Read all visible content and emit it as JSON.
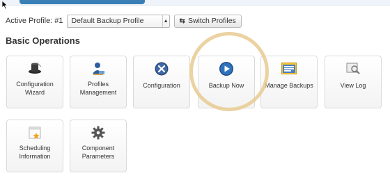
{
  "profile": {
    "label": "Active Profile: #1",
    "selected": "Default Backup Profile",
    "switch_label": "Switch Profiles"
  },
  "section": {
    "title": "Basic Operations"
  },
  "tiles": [
    {
      "label_line1": "Configuration",
      "label_line2": "Wizard",
      "icon": "top-hat-icon"
    },
    {
      "label_line1": "Profiles",
      "label_line2": "Management",
      "icon": "profiles-stamp-icon"
    },
    {
      "label_line1": "Configuration",
      "label_line2": "",
      "icon": "x-circle-icon"
    },
    {
      "label_line1": "Backup Now",
      "label_line2": "",
      "icon": "play-icon"
    },
    {
      "label_line1": "Manage Backups",
      "label_line2": "",
      "icon": "window-list-icon"
    },
    {
      "label_line1": "View Log",
      "label_line2": "",
      "icon": "magnifier-icon"
    },
    {
      "label_line1": "Scheduling",
      "label_line2": "Information",
      "icon": "calendar-star-icon"
    },
    {
      "label_line1": "Component",
      "label_line2": "Parameters",
      "icon": "gear-icon"
    }
  ],
  "colors": {
    "accent": "#3a7fb5",
    "highlight": "#e8ca91"
  }
}
